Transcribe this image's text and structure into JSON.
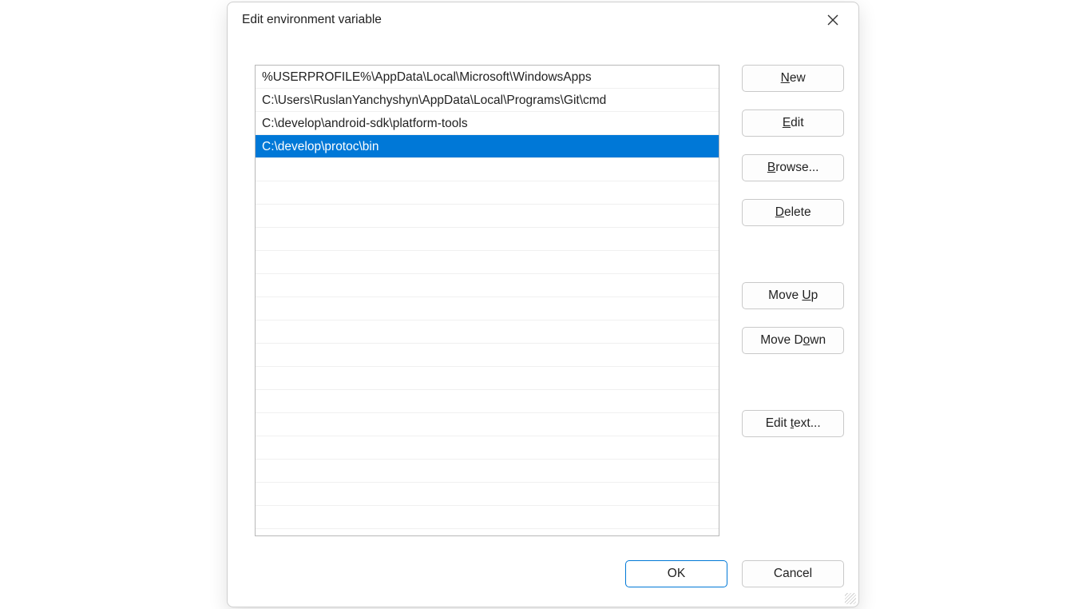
{
  "dialog": {
    "title": "Edit environment variable",
    "paths": [
      "%USERPROFILE%\\AppData\\Local\\Microsoft\\WindowsApps",
      "C:\\Users\\RuslanYanchyshyn\\AppData\\Local\\Programs\\Git\\cmd",
      "C:\\develop\\android-sdk\\platform-tools",
      "C:\\develop\\protoc\\bin"
    ],
    "selected_index": 3,
    "empty_rows": 16
  },
  "buttons": {
    "new": {
      "pre": "",
      "mn": "N",
      "post": "ew"
    },
    "edit": {
      "pre": "",
      "mn": "E",
      "post": "dit"
    },
    "browse": {
      "pre": "",
      "mn": "B",
      "post": "rowse..."
    },
    "delete": {
      "pre": "",
      "mn": "D",
      "post": "elete"
    },
    "move_up": {
      "pre": "Move ",
      "mn": "U",
      "post": "p"
    },
    "move_down": {
      "pre": "Move D",
      "mn": "o",
      "post": "wn"
    },
    "edit_text": {
      "pre": "Edit ",
      "mn": "t",
      "post": "ext..."
    },
    "ok": "OK",
    "cancel": "Cancel"
  }
}
